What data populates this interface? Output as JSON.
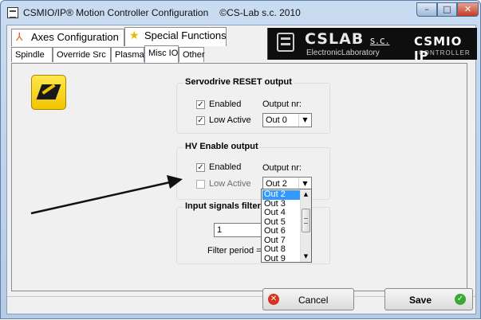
{
  "window": {
    "title": "CSMIO/IP® Motion Controller Configuration",
    "copyright": "©CS-Lab s.c. 2010",
    "app_icon": "cslab-app-icon",
    "controls": {
      "minimize": "–",
      "maximize": "□",
      "close": "✕"
    }
  },
  "main_tabs": [
    {
      "label": "Axes Configuration",
      "icon": "axes-icon",
      "glyph": "⅄",
      "color": "#d2691e",
      "active": false
    },
    {
      "label": "Special Functions",
      "icon": "star-icon",
      "glyph": "★",
      "color": "#f0b400",
      "active": true
    }
  ],
  "logo": {
    "brand": "CSLAB",
    "brand_suffix": "s.c.",
    "subtitle": "ElectronicLaboratory",
    "product": "CSMIO IP",
    "product_sub": "CONTROLLER"
  },
  "sub_tabs": [
    {
      "label": "Spindle",
      "active": false
    },
    {
      "label": "Override Src",
      "active": false
    },
    {
      "label": "Plasma",
      "active": false
    },
    {
      "label": "Misc IO",
      "active": true
    },
    {
      "label": "Other",
      "active": false
    }
  ],
  "misc_icon": "io-module-icon",
  "servo_reset": {
    "title": "Servodrive RESET output",
    "enabled_label": "Enabled",
    "enabled_checked": true,
    "low_active_label": "Low Active",
    "low_active_checked": true,
    "output_label": "Output nr:",
    "output_value": "Out 0"
  },
  "hv_enable": {
    "title": "HV Enable output",
    "enabled_label": "Enabled",
    "enabled_checked": true,
    "low_active_label": "Low Active",
    "low_active_checked": false,
    "output_label": "Output nr:",
    "output_value": "Out 2",
    "options": [
      "Out 2",
      "Out 3",
      "Out 4",
      "Out 5",
      "Out 6",
      "Out 7",
      "Out 8",
      "Out 9"
    ],
    "selected": "Out 2"
  },
  "input_filter": {
    "title": "Input signals filter",
    "value": "1",
    "period_label": "Filter period ="
  },
  "buttons": {
    "cancel": "Cancel",
    "save": "Save"
  },
  "check_glyph": "✓"
}
